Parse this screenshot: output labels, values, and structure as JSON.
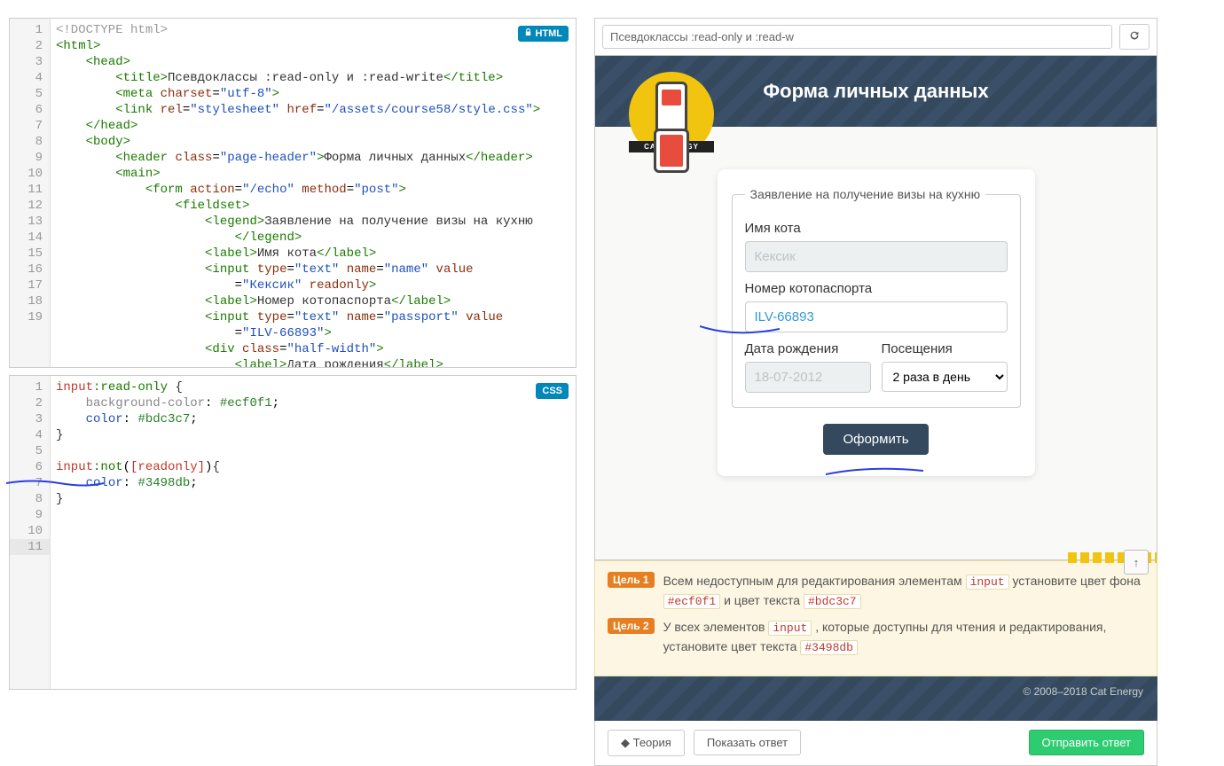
{
  "editors": {
    "html": {
      "badge": "HTML",
      "line_count": 19,
      "lines": [
        {
          "n": 1,
          "html": "<span class='t-dec'>&lt;!DOCTYPE html&gt;</span>"
        },
        {
          "n": 2,
          "html": "<span class='t-tag'>&lt;html&gt;</span>"
        },
        {
          "n": 3,
          "html": "    <span class='t-tag'>&lt;head&gt;</span>"
        },
        {
          "n": 4,
          "html": "        <span class='t-tag'>&lt;title&gt;</span><span class='t-txt'>Псевдоклассы :read-only и :read-write</span><span class='t-tag'>&lt;/title&gt;</span>"
        },
        {
          "n": 5,
          "html": "        <span class='t-tag'>&lt;meta</span> <span class='t-attr'>charset</span>=<span class='t-str'>\"utf-8\"</span><span class='t-tag'>&gt;</span>"
        },
        {
          "n": 6,
          "html": "        <span class='t-tag'>&lt;link</span> <span class='t-attr'>rel</span>=<span class='t-str'>\"stylesheet\"</span> <span class='t-attr'>href</span>=<span class='t-str'>\"/assets/course58/style.css\"</span><span class='t-tag'>&gt;</span>"
        },
        {
          "n": 7,
          "html": "    <span class='t-tag'>&lt;/head&gt;</span>"
        },
        {
          "n": 8,
          "html": "    <span class='t-tag'>&lt;body&gt;</span>"
        },
        {
          "n": 9,
          "html": "        <span class='t-tag'>&lt;header</span> <span class='t-attr'>class</span>=<span class='t-str'>\"page-header\"</span><span class='t-tag'>&gt;</span><span class='t-txt'>Форма личных данных</span><span class='t-tag'>&lt;/header&gt;</span>"
        },
        {
          "n": 10,
          "html": "        <span class='t-tag'>&lt;main&gt;</span>"
        },
        {
          "n": 11,
          "html": "            <span class='t-tag'>&lt;form</span> <span class='t-attr'>action</span>=<span class='t-str'>\"/echo\"</span> <span class='t-attr'>method</span>=<span class='t-str'>\"post\"</span><span class='t-tag'>&gt;</span>"
        },
        {
          "n": 12,
          "html": "                <span class='t-tag'>&lt;fieldset&gt;</span>"
        },
        {
          "n": 13,
          "html": "                    <span class='t-tag'>&lt;legend&gt;</span><span class='t-txt'>Заявление на получение визы на кухню</span>\n                        <span class='t-tag'>&lt;/legend&gt;</span>"
        },
        {
          "n": 14,
          "html": "                    <span class='t-tag'>&lt;label&gt;</span><span class='t-txt'>Имя кота</span><span class='t-tag'>&lt;/label&gt;</span>"
        },
        {
          "n": 15,
          "html": "                    <span class='t-tag'>&lt;input</span> <span class='t-attr'>type</span>=<span class='t-str'>\"text\"</span> <span class='t-attr'>name</span>=<span class='t-str'>\"name\"</span> <span class='t-attr'>value</span>\n                        =<span class='t-str'>\"Кексик\"</span> <span class='t-attr'>readonly</span><span class='t-tag'>&gt;</span>"
        },
        {
          "n": 16,
          "html": "                    <span class='t-tag'>&lt;label&gt;</span><span class='t-txt'>Номер котопаспорта</span><span class='t-tag'>&lt;/label&gt;</span>"
        },
        {
          "n": 17,
          "html": "                    <span class='t-tag'>&lt;input</span> <span class='t-attr'>type</span>=<span class='t-str'>\"text\"</span> <span class='t-attr'>name</span>=<span class='t-str'>\"passport\"</span> <span class='t-attr'>value</span>\n                        =<span class='t-str'>\"ILV-66893\"</span><span class='t-tag'>&gt;</span>"
        },
        {
          "n": 18,
          "html": "                    <span class='t-tag'>&lt;div</span> <span class='t-attr'>class</span>=<span class='t-str'>\"half-width\"</span><span class='t-tag'>&gt;</span>"
        },
        {
          "n": 19,
          "html": "                        <span class='t-tag'>&lt;label&gt;</span><span class='t-txt'>Дата рождения</span><span class='t-tag'>&lt;/label&gt;</span>"
        }
      ]
    },
    "css": {
      "badge": "CSS",
      "line_count": 11,
      "active_line": 11,
      "lines": [
        {
          "n": 1,
          "html": "<span class='t-sel-red'>input</span><span class='t-sel'>:read-only</span> <span class='t-brace'>{</span>"
        },
        {
          "n": 2,
          "html": "    <span class='t-prop-gray'>background-color</span>: <span class='t-val-hex'>#ecf0f1</span>;"
        },
        {
          "n": 3,
          "html": "    <span class='t-prop'>color</span>: <span class='t-val-hex'>#bdc3c7</span>;"
        },
        {
          "n": 4,
          "html": "<span class='t-brace'>}</span>"
        },
        {
          "n": 5,
          "html": ""
        },
        {
          "n": 6,
          "html": "<span class='t-sel-red'>input</span><span class='t-sel'>:not</span>(<span class='t-sel-red'>[readonly]</span>)<span class='t-brace'>{</span>"
        },
        {
          "n": 7,
          "html": "    <span class='t-prop'>color</span>: <span class='t-val-hex'>#3498db</span>;"
        },
        {
          "n": 8,
          "html": "<span class='t-brace'>}</span>"
        },
        {
          "n": 9,
          "html": ""
        },
        {
          "n": 10,
          "html": ""
        },
        {
          "n": 11,
          "html": ""
        }
      ]
    }
  },
  "preview": {
    "title": "Псевдоклассы :read-only и :read-w",
    "header": "Форма личных данных",
    "logo_text": "CAT ENERGY",
    "form": {
      "legend": "Заявление на получение визы на кухню",
      "name_label": "Имя кота",
      "name_value": "Кексик",
      "passport_label": "Номер котопаспорта",
      "passport_value": "ILV-66893",
      "dob_label": "Дата рождения",
      "dob_value": "18-07-2012",
      "visits_label": "Посещения",
      "visits_value": "2 раза в день",
      "submit": "Оформить"
    },
    "footer_text": "© 2008–2018 Cat Energy"
  },
  "goals": {
    "badge1": "Цель 1",
    "text1_a": "Всем недоступным для редактирования элементам ",
    "text1_code1": "input",
    "text1_b": " установите цвет фона ",
    "text1_code2": "#ecf0f1",
    "text1_c": " и цвет текста ",
    "text1_code3": "#bdc3c7",
    "badge2": "Цель 2",
    "text2_a": "У всех элементов ",
    "text2_code1": "input",
    "text2_b": " , которые доступны для чтения и редактирования, установите цвет текста ",
    "text2_code2": "#3498db"
  },
  "buttons": {
    "theory": "Теория",
    "show": "Показать ответ",
    "submit": "Отправить ответ"
  }
}
